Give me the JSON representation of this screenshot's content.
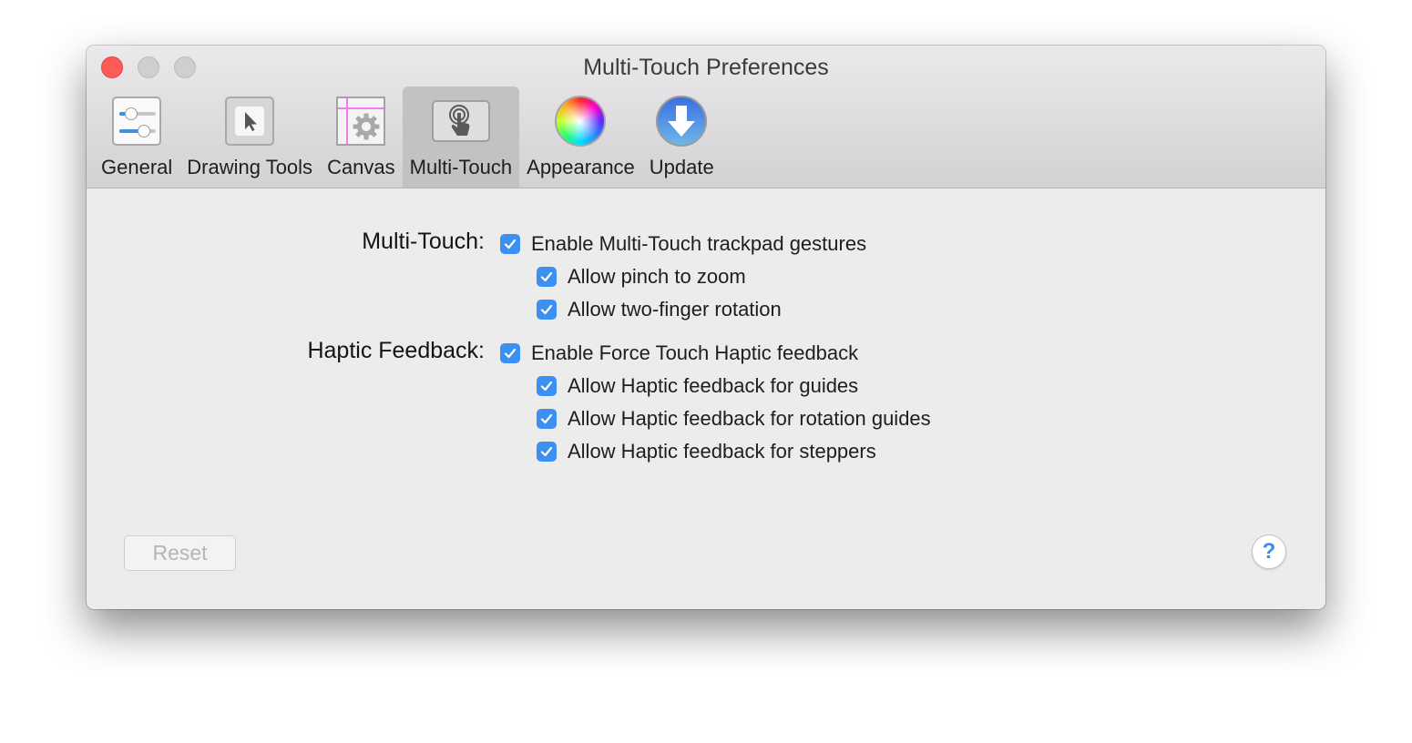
{
  "window": {
    "title": "Multi-Touch Preferences"
  },
  "toolbar": {
    "tabs": [
      {
        "label": "General",
        "icon": "sliders-icon",
        "selected": false
      },
      {
        "label": "Drawing Tools",
        "icon": "cursor-arrow-icon",
        "selected": false
      },
      {
        "label": "Canvas",
        "icon": "canvas-gear-icon",
        "selected": false
      },
      {
        "label": "Multi-Touch",
        "icon": "touch-hand-icon",
        "selected": true
      },
      {
        "label": "Appearance",
        "icon": "color-wheel-icon",
        "selected": false
      },
      {
        "label": "Update",
        "icon": "download-arrow-icon",
        "selected": false
      }
    ]
  },
  "sections": {
    "multitouch": {
      "label": "Multi-Touch:",
      "options": [
        {
          "label": "Enable Multi-Touch trackpad gestures",
          "checked": true
        },
        {
          "label": "Allow pinch to zoom",
          "checked": true
        },
        {
          "label": "Allow two-finger rotation",
          "checked": true
        }
      ]
    },
    "haptic": {
      "label": "Haptic Feedback:",
      "options": [
        {
          "label": "Enable Force Touch Haptic feedback",
          "checked": true
        },
        {
          "label": "Allow Haptic feedback for guides",
          "checked": true
        },
        {
          "label": "Allow Haptic feedback for rotation guides",
          "checked": true
        },
        {
          "label": "Allow Haptic feedback for steppers",
          "checked": true
        }
      ]
    }
  },
  "footer": {
    "reset_label": "Reset",
    "help_label": "?"
  },
  "colors": {
    "accent": "#3c90f2",
    "close": "#fc5b57"
  }
}
